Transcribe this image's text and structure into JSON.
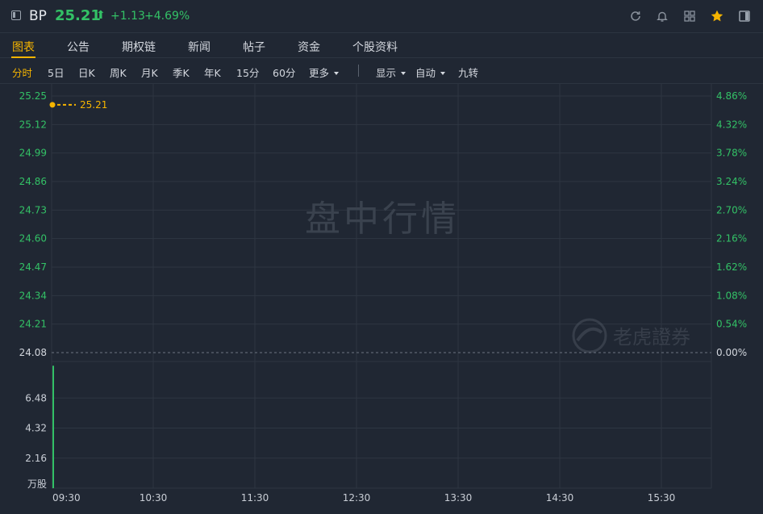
{
  "header": {
    "ticker": "BP",
    "price": "25.21",
    "arrow": "⬆",
    "change": "+1.13",
    "change_pct": "+4.69%"
  },
  "tabs": [
    "图表",
    "公告",
    "期权链",
    "新闻",
    "帖子",
    "资金",
    "个股资料"
  ],
  "periods": [
    "分时",
    "5日",
    "日K",
    "周K",
    "月K",
    "季K",
    "年K",
    "15分",
    "60分",
    "更多"
  ],
  "options": [
    "显示",
    "自动",
    "九转"
  ],
  "watermark": "盘中行情",
  "brand": "老虎證券",
  "colors": {
    "up": "#33c166",
    "accent": "#f5b400",
    "background": "#202733"
  },
  "chart_data": {
    "type": "line",
    "price_axis": [
      "25.25",
      "25.12",
      "24.99",
      "24.86",
      "24.73",
      "24.60",
      "24.47",
      "24.34",
      "24.21",
      "24.08"
    ],
    "pct_axis": [
      "4.86%",
      "4.32%",
      "3.78%",
      "3.24%",
      "2.70%",
      "2.16%",
      "1.62%",
      "1.08%",
      "0.54%",
      "0.00%"
    ],
    "volume_axis": [
      "6.48",
      "4.32",
      "2.16"
    ],
    "volume_unit": "万股",
    "time_axis": [
      "09:30",
      "10:30",
      "11:30",
      "12:30",
      "13:30",
      "14:30",
      "15:30"
    ],
    "prev_close": 24.08,
    "ylim": [
      24.08,
      25.25
    ],
    "last_price": 25.21,
    "last_price_label": "25.21",
    "price_points": [
      {
        "time": "09:30",
        "price": 25.21
      }
    ],
    "volume_points": [
      {
        "time": "09:30",
        "volume": 8.8
      }
    ],
    "volume_ylim": [
      0,
      8.64
    ],
    "grid": true
  }
}
